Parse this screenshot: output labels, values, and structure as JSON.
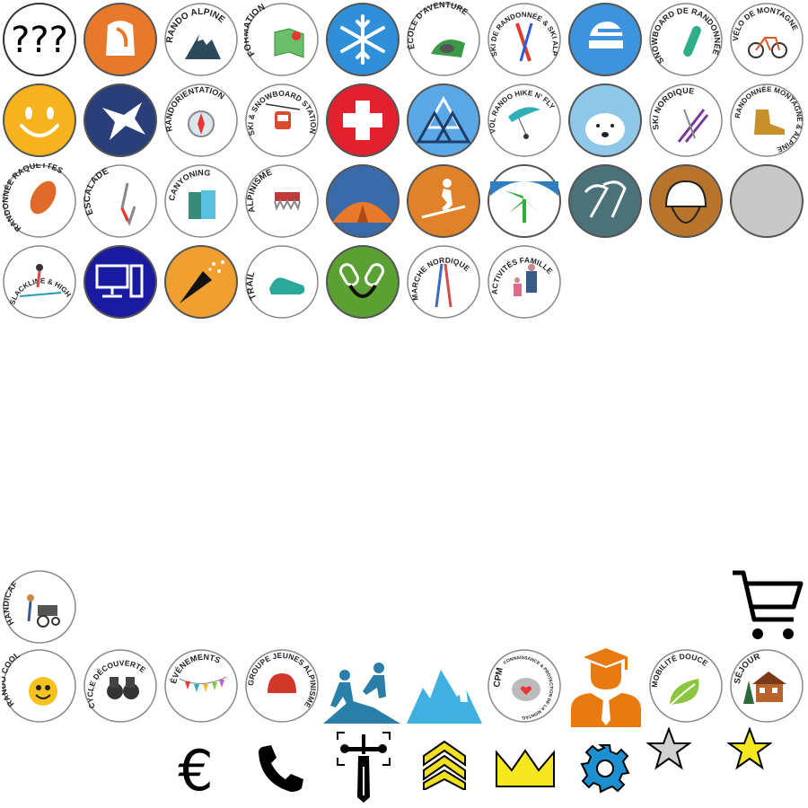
{
  "badges": {
    "unknown": {
      "label": "???"
    },
    "rando_alpine": {
      "label": "RANDO ALPINE"
    },
    "formation": {
      "label": "FORMATION"
    },
    "ecole_aventure": {
      "label": "ÉCOLE D'AVENTURE"
    },
    "ski_rando": {
      "label": "SKI DE RANDONNÉE & SKI ALPINISME"
    },
    "snowboard_rando": {
      "label": "SNOWBOARD DE RANDONNÉE"
    },
    "velo_montagne": {
      "label": "VÉLO DE MONTAGNE"
    },
    "randorientation": {
      "label": "RANDORIENTATION"
    },
    "ski_snowboard_station": {
      "label": "SKI & SNOWBOARD STATION"
    },
    "vol_rando": {
      "label": "VOL RANDO HIKE N' FLY"
    },
    "ski_nordique": {
      "label": "SKI NORDIQUE"
    },
    "rando_montagne": {
      "label": "RANDONNÉE MONTAGNE & ALPINE"
    },
    "rando_raquettes": {
      "label": "RANDONNÉE RAQUETTES"
    },
    "escalade": {
      "label": "ESCALADE"
    },
    "canyoning": {
      "label": "CANYONING"
    },
    "alpinisme": {
      "label": "ALPINISME"
    },
    "slackline": {
      "label": "SLACKLINE & HIGHLINE"
    },
    "trail": {
      "label": "TRAIL"
    },
    "marche_nordique": {
      "label": "MARCHE NORDIQUE"
    },
    "activites_famille": {
      "label": "ACTIVITÉS FAMILLE"
    },
    "handicaf": {
      "label": "HANDICAF"
    },
    "rando_cool": {
      "label": "RANDO COOL"
    },
    "cycle_decouverte": {
      "label": "CYCLE DÉCOUVERTE"
    },
    "evenements": {
      "label": "ÉVÉNEMENTS"
    },
    "groupe_jeunes": {
      "label": "GROUPE JEUNES ALPINISME"
    },
    "cpm": {
      "label": "CPM",
      "sublabel": "CONNAISSANCE & PROTECTION DE LA MONTAGNE"
    },
    "mobilite_douce": {
      "label": "MOBILITÉ DOUCE"
    },
    "sejour": {
      "label": "SÉJOUR"
    }
  },
  "symbols": {
    "euro": "€"
  },
  "colors": {
    "orange": "#e8792b",
    "blue": "#2f8fd8",
    "red": "#e3202e",
    "light_blue": "#5aa9e6",
    "slate": "#4a7278",
    "brown": "#b8732c",
    "grey": "#c8c8c8",
    "navy": "#1a1aa0",
    "amber": "#f0a030",
    "green": "#5aa032",
    "yellow": "#f5c518",
    "teal": "#2a7fa8",
    "sky": "#3fb0e0",
    "gear": "#1b8fd0"
  }
}
